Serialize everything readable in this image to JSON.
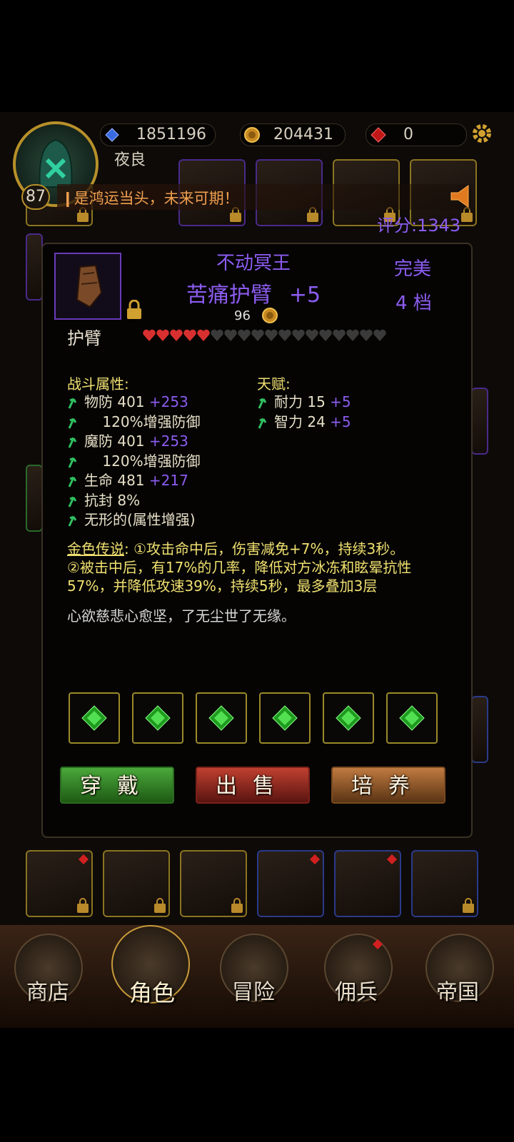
{
  "header": {
    "currency1": "1851196",
    "currency2": "204431",
    "currency3": "0",
    "player_name": "夜良",
    "level": "87",
    "broadcast": "❙是鸿运当头，未来可期！",
    "score": "评分:1343"
  },
  "item": {
    "series": "不动冥王",
    "name": "苦痛护臂",
    "enhance": "+5",
    "quality": "完美",
    "grade": "4 档",
    "price": "96",
    "slot_type": "护臂",
    "stars_filled": 5,
    "stars_total": 18
  },
  "combat": {
    "heading": "战斗属性:",
    "lines": [
      {
        "text": "物防 401 ",
        "plus": "+253"
      },
      {
        "text": "    120%增强防御",
        "plus": ""
      },
      {
        "text": "魔防 401 ",
        "plus": "+253"
      },
      {
        "text": "    120%增强防御",
        "plus": ""
      },
      {
        "text": "生命 481 ",
        "plus": "+217"
      },
      {
        "text": "抗封 8%",
        "plus": ""
      },
      {
        "text": "无形的(属性增强)",
        "plus": ""
      }
    ]
  },
  "talent": {
    "heading": "天赋:",
    "lines": [
      {
        "text": "耐力 15 ",
        "plus": "+5"
      },
      {
        "text": "智力 24 ",
        "plus": "+5"
      }
    ]
  },
  "legend": {
    "label": "金色传说",
    "colon": ": ",
    "line1": "①攻击命中后，伤害减免+7%，持续3秒。",
    "line2": "②被击中后，有17%的几率，降低对方冰冻和眩晕抗性",
    "line3": "57%，并降低攻速39%，持续5秒，最多叠加3层"
  },
  "flavor": "心欲慈悲心愈坚，了无尘世了无缘。",
  "buttons": {
    "equip": "穿戴",
    "sell": "出售",
    "train": "培养"
  },
  "nav": {
    "shop": "商店",
    "role": "角色",
    "adventure": "冒险",
    "mercenary": "佣兵",
    "empire": "帝国"
  },
  "colors": {
    "purple_text": "#8c5cf0",
    "gold_text": "#f0e070",
    "heart_red": "#d83030",
    "gem_green": "#2ec02e"
  },
  "icons": [
    "gear-icon",
    "blue-gem-icon",
    "gold-coin-icon",
    "red-gem-icon",
    "horn-icon",
    "lock-icon",
    "green-gem-icon",
    "up-arrow-icon",
    "heart-icon"
  ]
}
